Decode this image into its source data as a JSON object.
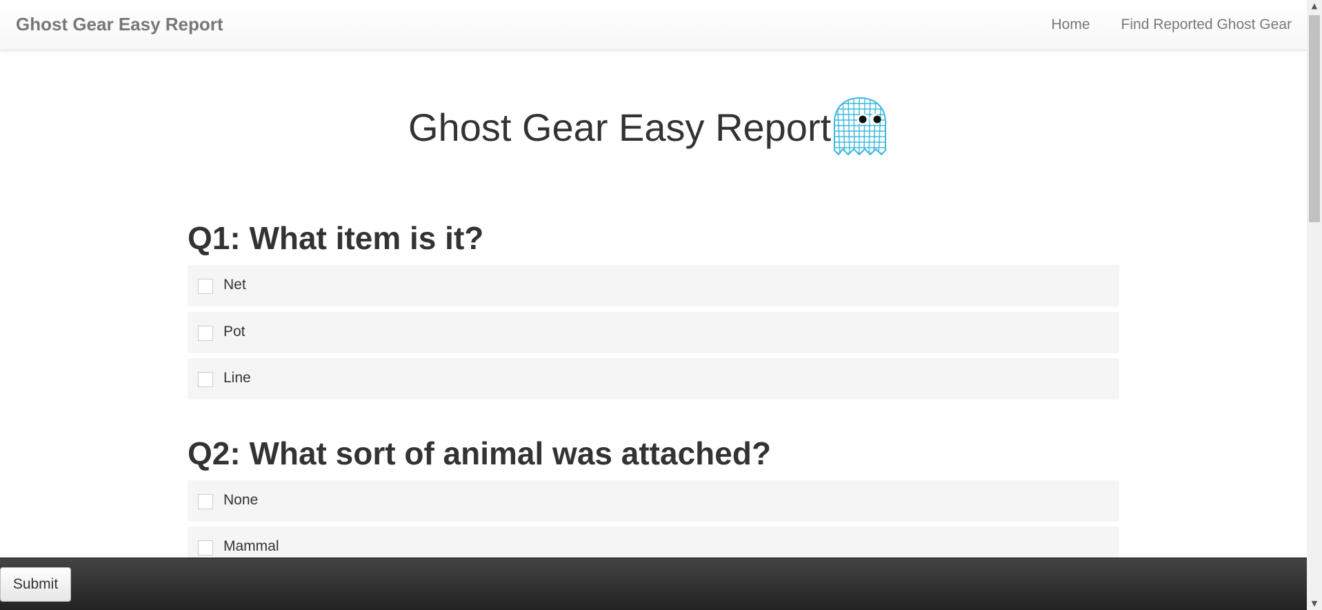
{
  "navbar": {
    "brand": "Ghost Gear Easy Report",
    "links": [
      {
        "label": "Home"
      },
      {
        "label": "Find Reported Ghost Gear"
      }
    ]
  },
  "main": {
    "title": "Ghost Gear Easy Report",
    "logo_icon": "ghost-net-icon",
    "q1": {
      "title": "Q1: What item is it?",
      "options": [
        {
          "label": "Net",
          "checked": false
        },
        {
          "label": "Pot",
          "checked": false
        },
        {
          "label": "Line",
          "checked": false
        }
      ]
    },
    "q2": {
      "title": "Q2: What sort of animal was attached?",
      "options": [
        {
          "label": "None",
          "checked": false
        },
        {
          "label": "Mammal",
          "checked": false
        }
      ]
    }
  },
  "footer": {
    "submit_label": "Submit"
  },
  "colors": {
    "logo_blue": "#3bb8dd",
    "option_background": "#f5f5f5",
    "footer_dark": "#2a2a2a"
  }
}
